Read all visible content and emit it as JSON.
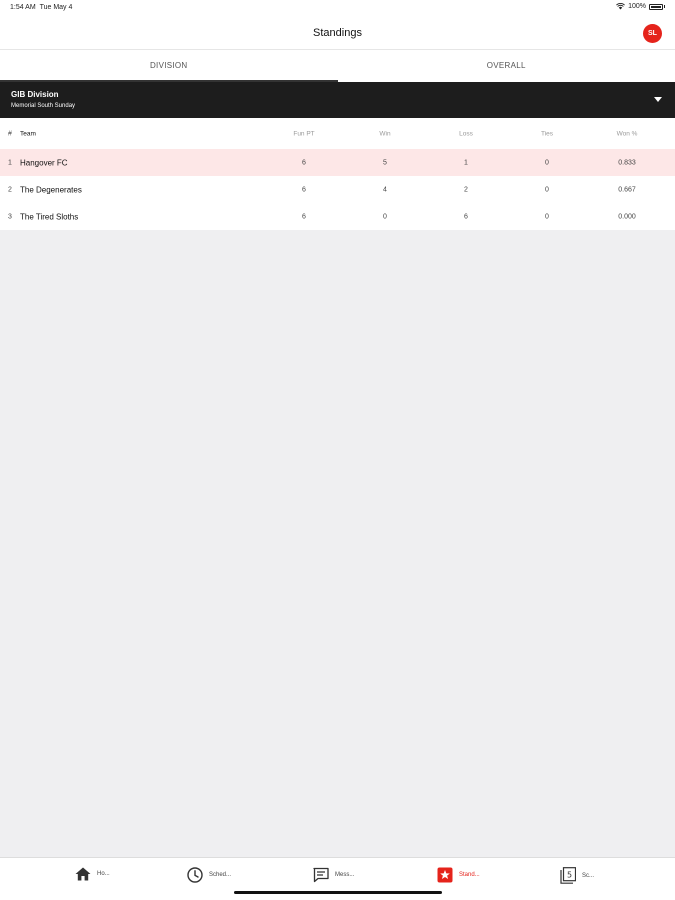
{
  "status_bar": {
    "time": "1:54 AM",
    "date": "Tue May 4",
    "battery": "100%"
  },
  "nav": {
    "title": "Standings",
    "avatar_initials": "SL"
  },
  "tabs": [
    {
      "label": "DIVISION",
      "active": true
    },
    {
      "label": "OVERALL",
      "active": false
    }
  ],
  "division": {
    "name": "GIB Division",
    "subtitle": "Memorial South Sunday"
  },
  "table": {
    "headers": {
      "num": "#",
      "team": "Team",
      "fun": "Fun PT",
      "win": "Win",
      "loss": "Loss",
      "ties": "Ties",
      "pct": "Won %"
    },
    "rows": [
      {
        "rank": "1",
        "team": "Hangover FC",
        "fun": "6",
        "win": "5",
        "loss": "1",
        "ties": "0",
        "pct": "0.833"
      },
      {
        "rank": "2",
        "team": "The Degenerates",
        "fun": "6",
        "win": "4",
        "loss": "2",
        "ties": "0",
        "pct": "0.667"
      },
      {
        "rank": "3",
        "team": "The Tired Sloths",
        "fun": "6",
        "win": "0",
        "loss": "6",
        "ties": "0",
        "pct": "0.000"
      }
    ]
  },
  "tab_bar": [
    {
      "label": "Ho...",
      "icon": "home-icon"
    },
    {
      "label": "Sched...",
      "icon": "clock-icon"
    },
    {
      "label": "Mess...",
      "icon": "message-icon"
    },
    {
      "label": "Stand...",
      "icon": "star-icon"
    },
    {
      "label": "Sc...",
      "icon": "scores-icon"
    }
  ],
  "colors": {
    "accent": "#e5231b",
    "highlight_row": "#fde7e7",
    "division_bg": "#1d1d1d"
  }
}
